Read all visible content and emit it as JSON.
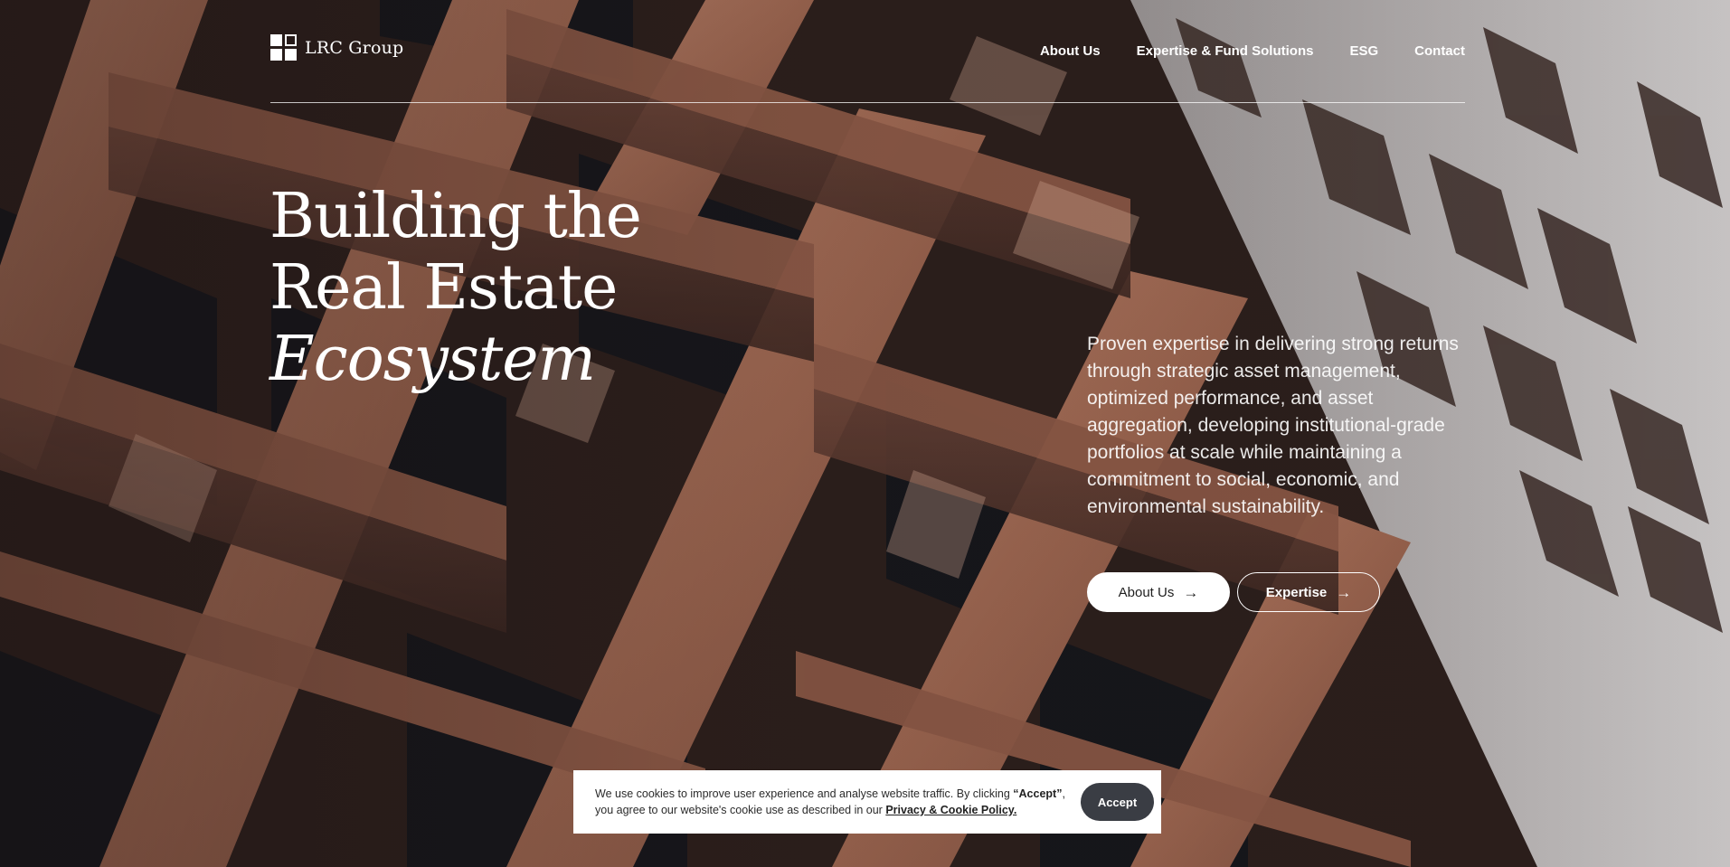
{
  "brand": {
    "name": "LRC Group"
  },
  "nav": {
    "items": [
      {
        "label": "About Us"
      },
      {
        "label": "Expertise & Fund Solutions"
      },
      {
        "label": "ESG"
      },
      {
        "label": "Contact"
      }
    ]
  },
  "hero": {
    "headline_line1": "Building the",
    "headline_line2": "Real Estate",
    "headline_line3": "Ecosystem",
    "intro": "Proven expertise in delivering strong returns through strategic asset management, optimized performance, and asset aggregation, developing institutional-grade portfolios at scale while maintaining a commitment to social, economic, and environmental sustainability.",
    "buttons": {
      "about_label": "About Us",
      "expertise_label": "Expertise",
      "arrow": "→"
    }
  },
  "cookie": {
    "text_part1": "We use cookies to improve user experience and analyse website traffic. By clicking ",
    "accept_quote": "“Accept”",
    "text_part2": ", you agree to our website's cookie use as described in our ",
    "policy_link": "Privacy & Cookie Policy.",
    "accept_label": "Accept"
  },
  "colors": {
    "copper": "#b87a5e",
    "dark_window": "#1b1a1e",
    "facade_light": "#c9c6c6",
    "accept_button": "#3a3d44"
  }
}
